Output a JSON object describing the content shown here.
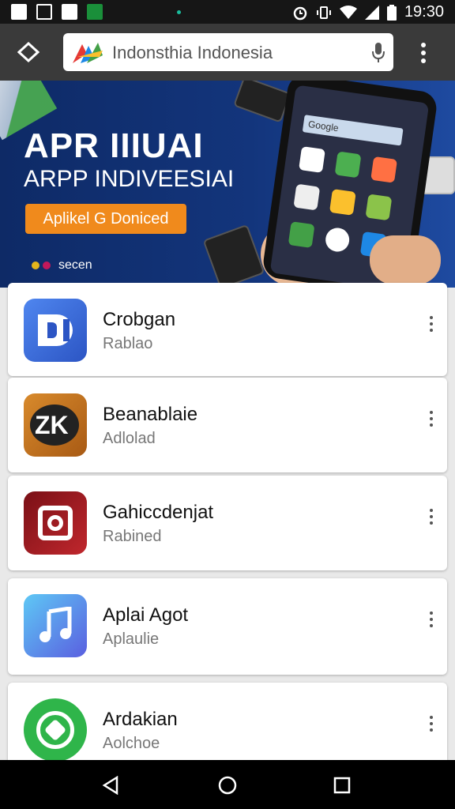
{
  "status_bar": {
    "time": "19:30",
    "left_icons": [
      "notification-icon",
      "screenshot-icon",
      "image-icon",
      "chart-icon"
    ],
    "right_icons": [
      "alarm-icon",
      "vibrate-icon",
      "wifi-icon",
      "signal-icon",
      "battery-icon"
    ]
  },
  "browser": {
    "url_text": "Indonsthia Indonesia",
    "home_icon": "home-icon",
    "mic_icon": "mic-icon",
    "menu_icon": "overflow-menu-icon"
  },
  "banner": {
    "title": "APR IIIUAI",
    "subtitle": "ARPP INDIVEESIAI",
    "button_label": "Aplikel G Doniced",
    "dots_label": "secen",
    "phone_search": "Google",
    "colors": {
      "background": "#13357c",
      "button": "#f08a1c"
    }
  },
  "apps": [
    {
      "name": "Crobgan",
      "sub": "Rablao",
      "icon": "di-app-icon",
      "color": "#3b6fd8"
    },
    {
      "name": "Beanablaie",
      "sub": "Adlolad",
      "icon": "zk-app-icon",
      "color": "#c77a22"
    },
    {
      "name": "Gahiccdenjat",
      "sub": "Rabined",
      "icon": "camera-app-icon",
      "color": "#b01e24"
    },
    {
      "name": "Aplai Agot",
      "sub": "Aplaulie",
      "icon": "music-app-icon",
      "color": "#4a86f0"
    },
    {
      "name": "Ardakian",
      "sub": "Aolchoe",
      "icon": "whatsapp-icon",
      "color": "#2fb54a"
    }
  ],
  "nav": {
    "back": "back-icon",
    "home": "home-circle-icon",
    "recents": "recents-icon"
  }
}
